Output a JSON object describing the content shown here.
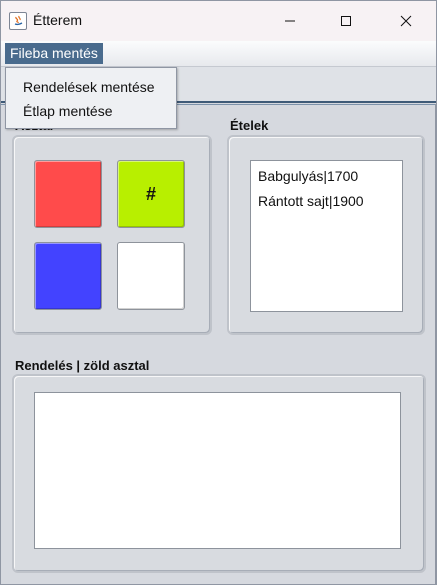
{
  "window": {
    "title": "Étterem"
  },
  "menubar": {
    "file_menu": "Fileba mentés"
  },
  "file_menu_items": [
    "Rendelések mentése",
    "Étlap mentése"
  ],
  "tables": {
    "label": "Asztal",
    "buttons": [
      {
        "color": "#ff4b4b",
        "label": ""
      },
      {
        "color": "#b8ef00",
        "label": "#"
      },
      {
        "color": "#4343ff",
        "label": ""
      },
      {
        "color": "#ffffff",
        "label": ""
      }
    ]
  },
  "food": {
    "label": "Ételek",
    "items": [
      "Babgulyás|1700",
      "Rántott sajt|1900"
    ]
  },
  "order": {
    "label": "Rendelés | zöld asztal",
    "content": ""
  },
  "icons": {
    "app": "java-icon",
    "minimize": "minimize-icon",
    "maximize": "maximize-icon",
    "close": "close-icon"
  }
}
